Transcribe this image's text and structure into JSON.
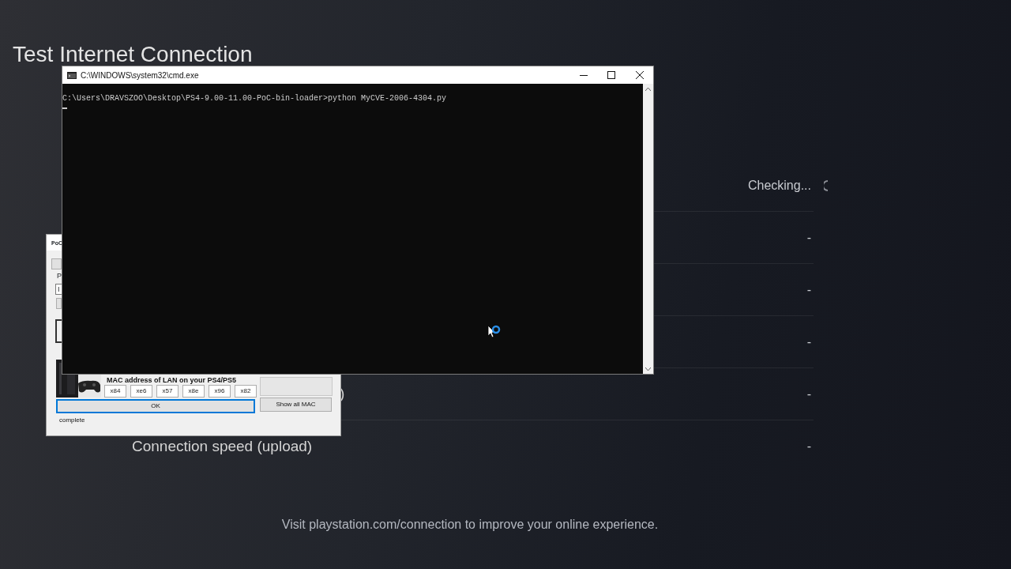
{
  "screen": {
    "title": "Test Internet Connection",
    "rows": [
      {
        "value": "Checking...",
        "busy": true
      },
      {
        "value": "-",
        "busy": false
      },
      {
        "value": "-",
        "busy": false
      },
      {
        "value": "-",
        "busy": false
      },
      {
        "kind": "cut",
        "label": ")",
        "value": "-",
        "busy": false
      },
      {
        "kind": "plain",
        "label": "Connection speed (upload)",
        "value": "-",
        "busy": false
      }
    ],
    "footer": "Visit playstation.com/connection to improve your online experience."
  },
  "poc_window": {
    "title": "PoC",
    "label_fragment": "P",
    "field_fragment": "I",
    "mac_heading": "MAC address of LAN on your PS4/PS5",
    "mac_bytes": [
      "x84",
      "xe6",
      "x57",
      "x8e",
      "x96",
      "x82"
    ],
    "ok_button": {
      "label": "OK",
      "focused": true
    },
    "show_all_button": "Show all MAC",
    "status": "complete"
  },
  "cmd_window": {
    "title": "C:\\WINDOWS\\system32\\cmd.exe",
    "lines": [
      "C:\\Users\\DRAVSZOO\\Desktop\\PS4-9.00-11.00-PoC-bin-loader>python MyCVE-2006-4304.py"
    ]
  }
}
